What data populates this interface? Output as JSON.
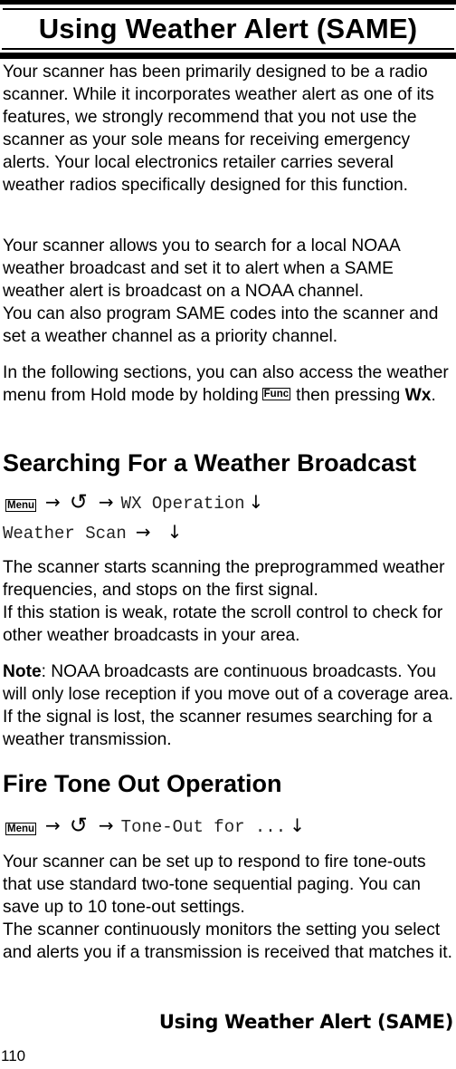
{
  "header": {
    "title": "Using Weather Alert (SAME)"
  },
  "intro": {
    "paragraph1": "Your scanner has been primarily designed to be a radio scanner. While it incorporates weather alert as one of its features, we strongly recommend that you not use the scanner as your sole means for receiving emergency alerts. Your local electronics retailer carries several weather radios specifically designed for this function.",
    "paragraph2_line1": "Your scanner allows you to search for a local NOAA weather broadcast and set it to alert when a SAME weather alert is broadcast on a NOAA channel.",
    "paragraph2_line2": "You can also program SAME codes into the scanner and set a weather channel as a priority channel.",
    "paragraph3_before_key": "In the following sections, you can also access the weather menu from Hold mode by holding",
    "paragraph3_key": "Func",
    "paragraph3_after_key": "then pressing",
    "paragraph3_bold": "Wx",
    "paragraph3_end": "."
  },
  "searching": {
    "heading": "Searching For a Weather Broadcast",
    "nav_line1": {
      "key": "Menu",
      "arrow1": "→",
      "rotate_icon": "↺",
      "arrow2": "→",
      "option": "WX Operation",
      "select": "↓"
    },
    "nav_line2": {
      "option": "Weather Scan",
      "arrow": "→",
      "select": "↓"
    },
    "paragraph1_line1": "The scanner starts scanning the preprogrammed weather frequencies, and stops on the first signal.",
    "paragraph1_line2": "If this station is weak, rotate the scroll control to check for other weather broadcasts in your area.",
    "note_label": "Note",
    "note_text": ": NOAA broadcasts are continuous broadcasts. You will only lose reception if you move out of a coverage area. If the signal is lost, the scanner resumes searching for a weather transmission."
  },
  "fire_tone": {
    "heading": "Fire Tone Out Operation",
    "nav_line": {
      "key": "Menu",
      "arrow1": "→",
      "rotate_icon": "↺",
      "arrow2": "→",
      "option": "Tone-Out for ...",
      "select": "↓"
    },
    "paragraph_line1": "Your scanner can be set up to respond to fire tone-outs that use standard two-tone sequential paging. You can save up to 10 tone-out settings.",
    "paragraph_line2": "The scanner continuously monitors the setting you select and alerts you if a transmission is received that matches it."
  },
  "footer": {
    "section_title": "Using Weather Alert (SAME)",
    "page_number": "110"
  }
}
